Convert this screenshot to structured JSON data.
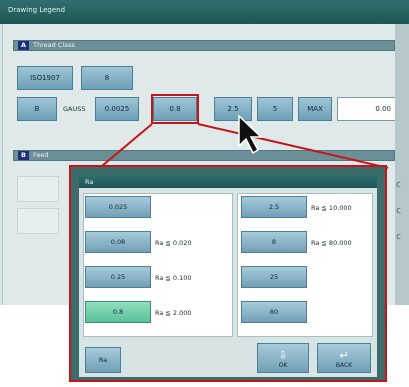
{
  "window": {
    "title": "Drawing Legend"
  },
  "section_a": {
    "tag": "A",
    "label": "Thread Class"
  },
  "row1": {
    "standard": "ISO1907",
    "value": "8"
  },
  "row2": {
    "type": "B",
    "unit_label": "GAUSS",
    "min_value": "0.0025",
    "selected_value": "0.8",
    "next_value": "2.5",
    "range_value": "5",
    "mode_label": "MAX",
    "input_value": "0.00"
  },
  "section_b": {
    "tag": "B",
    "label": "Feed"
  },
  "popup": {
    "title": "Ra",
    "left_options": [
      {
        "value": "0.025",
        "condition": "",
        "selected": false
      },
      {
        "value": "0.08",
        "condition": "Ra  ≦ 0.020",
        "selected": false
      },
      {
        "value": "0.25",
        "condition": "Ra  ≦ 0.100",
        "selected": false
      },
      {
        "value": "0.8",
        "condition": "Ra  ≦ 2.000",
        "selected": true
      }
    ],
    "right_options": [
      {
        "value": "2.5",
        "condition": "Ra  ≦ 10.000"
      },
      {
        "value": "8",
        "condition": "Ra  ≦ 80.000"
      },
      {
        "value": "25",
        "condition": ""
      },
      {
        "value": "80",
        "condition": ""
      }
    ],
    "footer": {
      "left_label": "Ra",
      "ok_label": "OK",
      "back_label": "BACK"
    }
  },
  "colors": {
    "highlight": "#c81418",
    "title_bar": "#2f6f6e",
    "selected_option": "#8fe0bc"
  },
  "icons": {
    "pointer": "arrow-cursor-icon",
    "ok": "ok-icon",
    "back": "back-icon"
  }
}
